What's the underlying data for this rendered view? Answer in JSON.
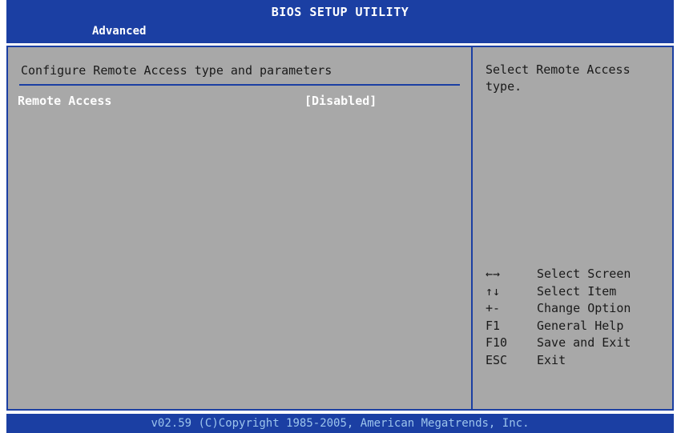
{
  "header": {
    "title": "BIOS SETUP UTILITY",
    "active_tab": "Advanced"
  },
  "main": {
    "section_title": "Configure Remote Access type and parameters",
    "options": [
      {
        "label": "Remote Access",
        "value": "[Disabled]"
      }
    ]
  },
  "help": {
    "text": "Select Remote Access type.",
    "keys": [
      {
        "key": "←→",
        "desc": "Select Screen"
      },
      {
        "key": "↑↓",
        "desc": "Select Item"
      },
      {
        "key": "+-",
        "desc": "Change Option"
      },
      {
        "key": "F1",
        "desc": "General Help"
      },
      {
        "key": "F10",
        "desc": "Save and Exit"
      },
      {
        "key": "ESC",
        "desc": "Exit"
      }
    ]
  },
  "footer": {
    "copyright": "v02.59 (C)Copyright 1985-2005, American Megatrends, Inc."
  },
  "colors": {
    "bar_blue": "#1b3fa3",
    "panel_gray": "#a8a8a8",
    "highlight_text": "#ffffff"
  }
}
